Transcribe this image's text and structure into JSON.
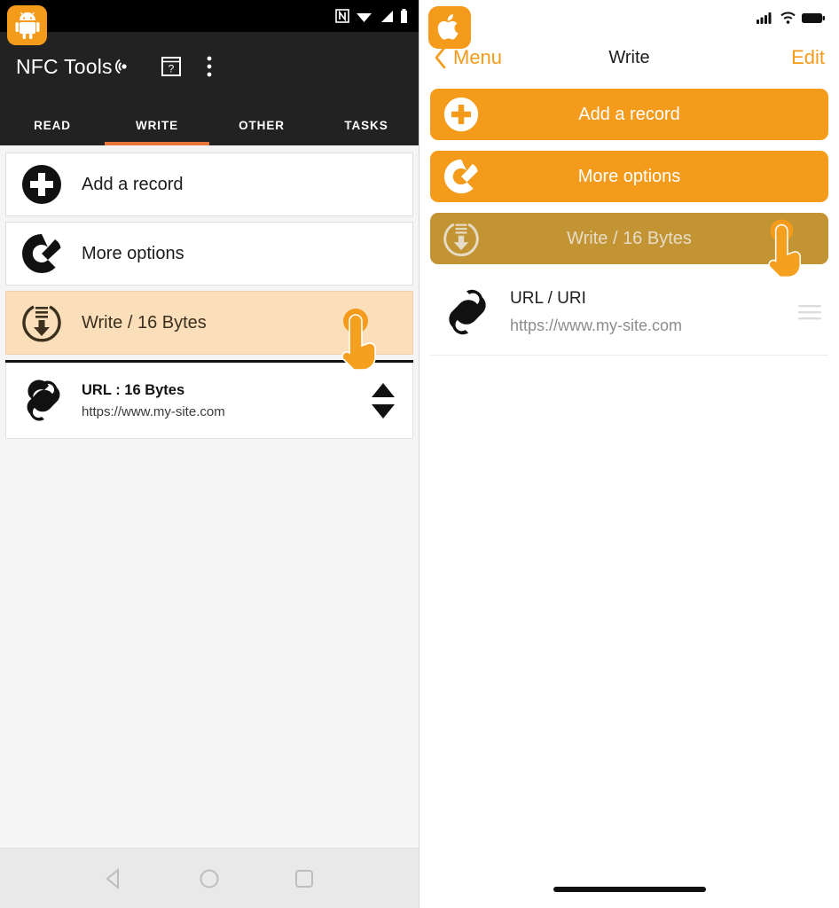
{
  "theme": {
    "brand_orange": "#f59b1c",
    "android_tab_underline": "#e8763a",
    "android_appbar": "#222222",
    "android_highlight_row": "#fbdfbb",
    "ios_disabled_button": "#c29434"
  },
  "android": {
    "status_bar": {
      "icons": [
        "nfc-icon",
        "wifi-icon",
        "cellular-signal-icon",
        "battery-icon"
      ]
    },
    "app_icon": "android-robot-icon",
    "title": "NFC Tools",
    "actions": [
      {
        "name": "nfc-scan-icon",
        "label": "NFC scan"
      },
      {
        "name": "help-book-icon",
        "label": "Help"
      },
      {
        "name": "overflow-menu-icon",
        "label": "More"
      }
    ],
    "tabs": [
      {
        "label": "READ",
        "active": false
      },
      {
        "label": "WRITE",
        "active": true
      },
      {
        "label": "OTHER",
        "active": false
      },
      {
        "label": "TASKS",
        "active": false
      }
    ],
    "cards": [
      {
        "icon": "plus-circle-icon",
        "label": "Add a record",
        "state": "normal"
      },
      {
        "icon": "wrench-circle-icon",
        "label": "More options",
        "state": "normal"
      },
      {
        "icon": "write-download-icon",
        "label": "Write / 16 Bytes",
        "state": "highlight"
      }
    ],
    "record": {
      "icon": "link-chain-icon",
      "title": "URL : 16 Bytes",
      "subtitle": "https://www.my-site.com",
      "reorder_icon": "up-down-arrows-icon"
    },
    "nav_bar": [
      {
        "name": "back-button",
        "icon": "triangle-back-icon"
      },
      {
        "name": "home-button",
        "icon": "circle-home-icon"
      },
      {
        "name": "recents-button",
        "icon": "square-recents-icon"
      }
    ],
    "tap_indicator": "pointing-hand-tap-icon"
  },
  "ios": {
    "status_bar": {
      "icons": [
        "cellular-signal-icon",
        "wifi-icon",
        "battery-icon"
      ]
    },
    "app_icon": "apple-logo-icon",
    "back_label": "Menu",
    "nav_title": "Write",
    "edit_label": "Edit",
    "buttons": [
      {
        "icon": "plus-circle-icon",
        "label": "Add a record",
        "state": "enabled"
      },
      {
        "icon": "wrench-circle-icon",
        "label": "More options",
        "state": "enabled"
      },
      {
        "icon": "write-download-icon",
        "label": "Write / 16 Bytes",
        "state": "disabled"
      }
    ],
    "record": {
      "icon": "link-chain-icon",
      "title": "URL / URI",
      "subtitle": "https://www.my-site.com",
      "reorder_icon": "reorder-handle-icon"
    },
    "tap_indicator": "pointing-hand-tap-icon"
  }
}
